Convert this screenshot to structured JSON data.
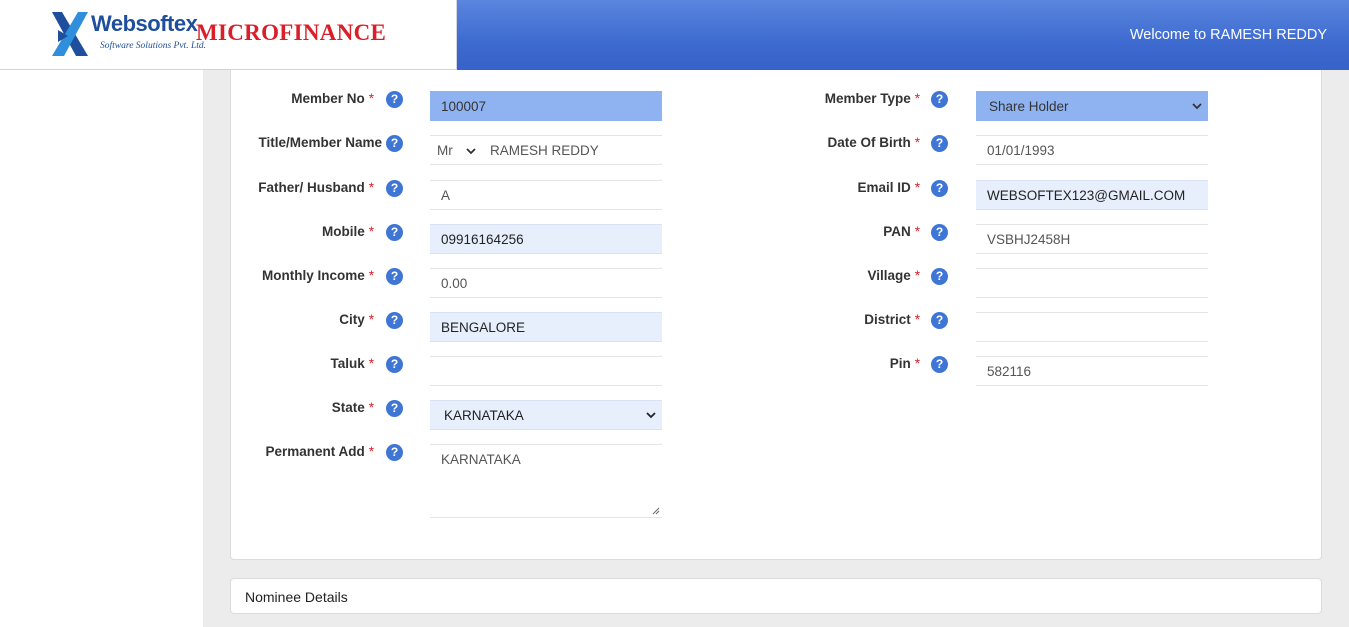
{
  "header": {
    "brand": "Websoftex",
    "brand_sub": "Software Solutions Pvt. Ltd.",
    "app_name": "MICROFINANCE",
    "welcome": "Welcome to RAMESH REDDY"
  },
  "form": {
    "member_no": {
      "label": "Member No",
      "value": "100007"
    },
    "title_member_name": {
      "label": "Title/Member Name",
      "title": "Mr",
      "value": "RAMESH  REDDY"
    },
    "father_husband": {
      "label": "Father/ Husband",
      "value": "A"
    },
    "mobile": {
      "label": "Mobile",
      "value": "09916164256"
    },
    "monthly_income": {
      "label": "Monthly Income",
      "value": "0.00"
    },
    "city": {
      "label": "City",
      "value": "BENGALORE"
    },
    "taluk": {
      "label": "Taluk",
      "value": ""
    },
    "state": {
      "label": "State",
      "value": "KARNATAKA"
    },
    "permanent_add": {
      "label": "Permanent Add",
      "value": "KARNATAKA"
    },
    "member_type": {
      "label": "Member Type",
      "value": "Share Holder"
    },
    "date_of_birth": {
      "label": "Date Of Birth",
      "value": "01/01/1993"
    },
    "email_id": {
      "label": "Email ID",
      "value": "WEBSOFTEX123@GMAIL.COM"
    },
    "pan": {
      "label": "PAN",
      "value": "VSBHJ2458H"
    },
    "village": {
      "label": "Village",
      "value": ""
    },
    "district": {
      "label": "District",
      "value": ""
    },
    "pin": {
      "label": "Pin",
      "value": "582116"
    }
  },
  "req_mark": "*",
  "help_glyph": "?",
  "nominee": {
    "title": "Nominee Details"
  },
  "colors": {
    "header_blue": "#3e6bd0",
    "brand_blue": "#1f4e9c",
    "brand_red": "#d9202a",
    "help_blue": "#3f76d6"
  }
}
